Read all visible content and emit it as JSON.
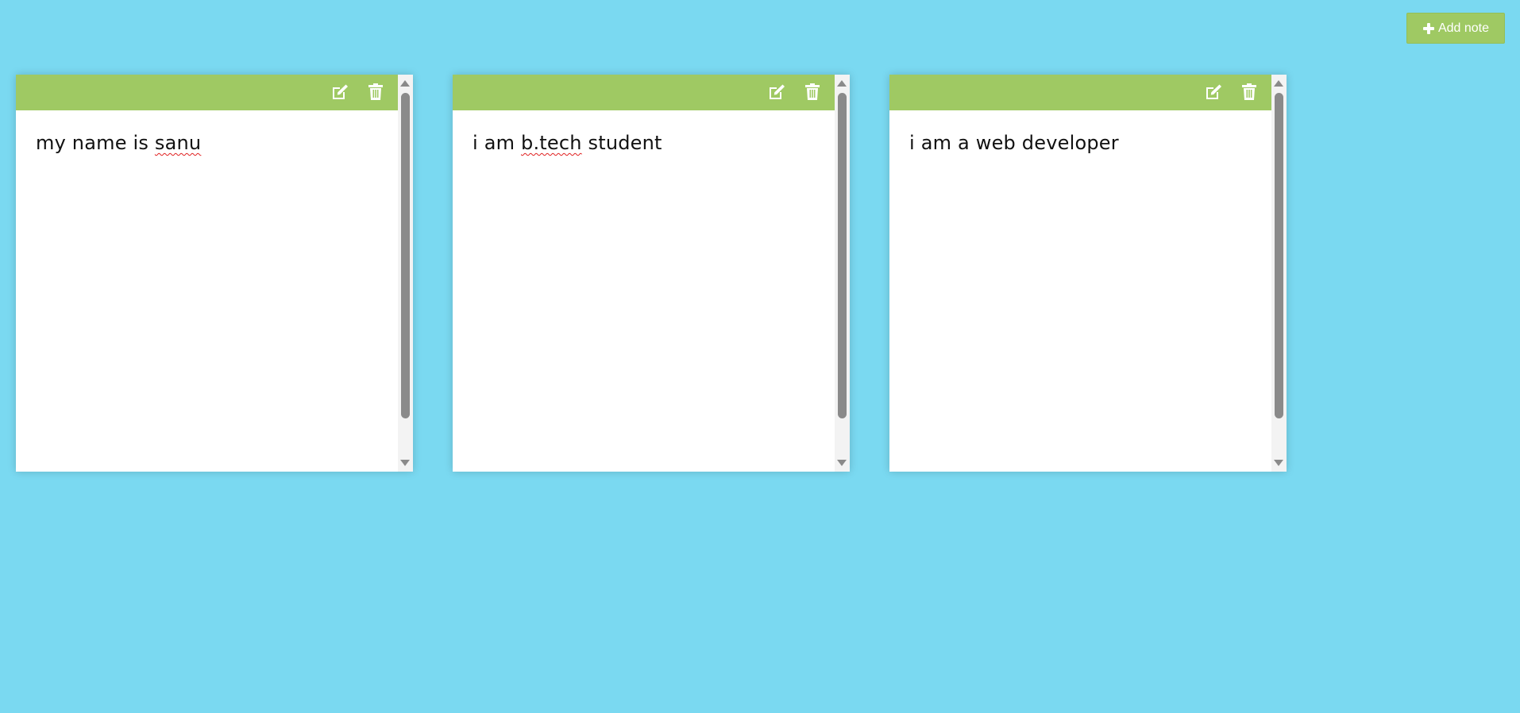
{
  "toolbar": {
    "add_note_label": "Add note",
    "add_icon": "plus-icon"
  },
  "colors": {
    "page_background": "#7ad9f1",
    "header_green": "#9fc963",
    "note_background": "#ffffff",
    "spellcheck_underline": "#e02020"
  },
  "notes": [
    {
      "text_before": "my name is ",
      "text_flagged": "sanu",
      "text_after": "",
      "icons": [
        "edit-icon",
        "trash-icon"
      ]
    },
    {
      "text_before": "i am ",
      "text_flagged": "b.tech",
      "text_after": " student",
      "icons": [
        "edit-icon",
        "trash-icon"
      ]
    },
    {
      "text_before": "i am a web developer",
      "text_flagged": "",
      "text_after": "",
      "icons": [
        "edit-icon",
        "trash-icon"
      ]
    }
  ]
}
